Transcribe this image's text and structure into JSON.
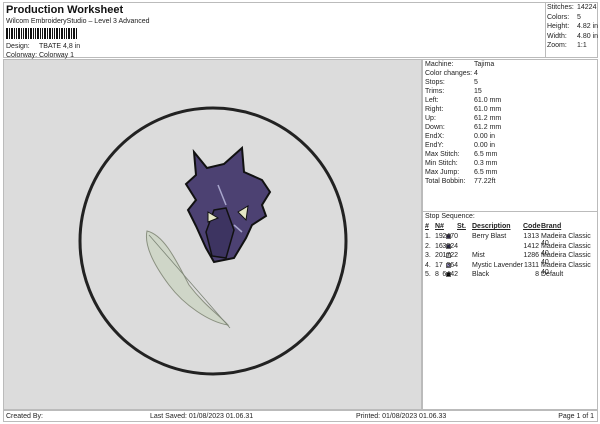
{
  "header": {
    "title": "Production Worksheet",
    "subtitle": "Wilcom EmbroideryStudio – Level 3 Advanced",
    "design_label": "Design:",
    "design_value": "TBATE 4,8 in",
    "colorway_label": "Colorway:",
    "colorway_value": "Colorway 1"
  },
  "stats": [
    {
      "label": "Stitches:",
      "value": "14224"
    },
    {
      "label": "Colors:",
      "value": "5"
    },
    {
      "label": "Height:",
      "value": "4.82 in"
    },
    {
      "label": "Width:",
      "value": "4.80 in"
    },
    {
      "label": "Zoom:",
      "value": "1:1"
    }
  ],
  "machine_info": [
    {
      "label": "Machine:",
      "value": "Tajima"
    },
    {
      "label": "Color changes:",
      "value": "4"
    },
    {
      "label": "Stops:",
      "value": "5"
    },
    {
      "label": "Trims:",
      "value": "15"
    },
    {
      "label": "Left:",
      "value": "61.0 mm"
    },
    {
      "label": "Right:",
      "value": "61.0 mm"
    },
    {
      "label": "Up:",
      "value": "61.2 mm"
    },
    {
      "label": "Down:",
      "value": "61.2 mm"
    },
    {
      "label": "EndX:",
      "value": "0.00 in"
    },
    {
      "label": "EndY:",
      "value": "0.00 in"
    },
    {
      "label": "Max Stitch:",
      "value": "6.5 mm"
    },
    {
      "label": "Min Stitch:",
      "value": "0.3 mm"
    },
    {
      "label": "Max Jump:",
      "value": "6.5 mm"
    },
    {
      "label": "Total Bobbin:",
      "value": "77.22ft"
    }
  ],
  "stop_sequence": {
    "title": "Stop Sequence:",
    "headers": {
      "num": "#",
      "n": "N#",
      "st": "St.",
      "desc": "Description",
      "code": "Code",
      "brand": "Brand"
    },
    "rows": [
      {
        "num": "1.",
        "n": "19",
        "color": "#3a2f5a",
        "st": "2470",
        "desc": "Berry Blast",
        "code": "1313",
        "brand": "Madeira Classic 40"
      },
      {
        "num": "2.",
        "n": "16",
        "color": "#2e2a52",
        "st": "3224",
        "desc": "",
        "code": "1412",
        "brand": "Madeira Classic 40"
      },
      {
        "num": "3.",
        "n": "20",
        "color": "#d8d8d8",
        "st": "1722",
        "desc": "Mist",
        "code": "1286",
        "brand": "Madeira Classic 40"
      },
      {
        "num": "4.",
        "n": "17",
        "color": "#9a92c8",
        "st": "364",
        "desc": "Mystic Lavender",
        "code": "1311",
        "brand": "Madeira Classic 40"
      },
      {
        "num": "5.",
        "n": "8",
        "color": "#000000",
        "st": "6442",
        "desc": "Black",
        "code": "8",
        "brand": "Default"
      }
    ]
  },
  "footer": {
    "created_by": "Created By:",
    "last_saved": "Last Saved: 01/08/2023 01.06.31",
    "printed": "Printed: 01/08/2023 01.06.33",
    "page": "Page 1 of 1"
  }
}
